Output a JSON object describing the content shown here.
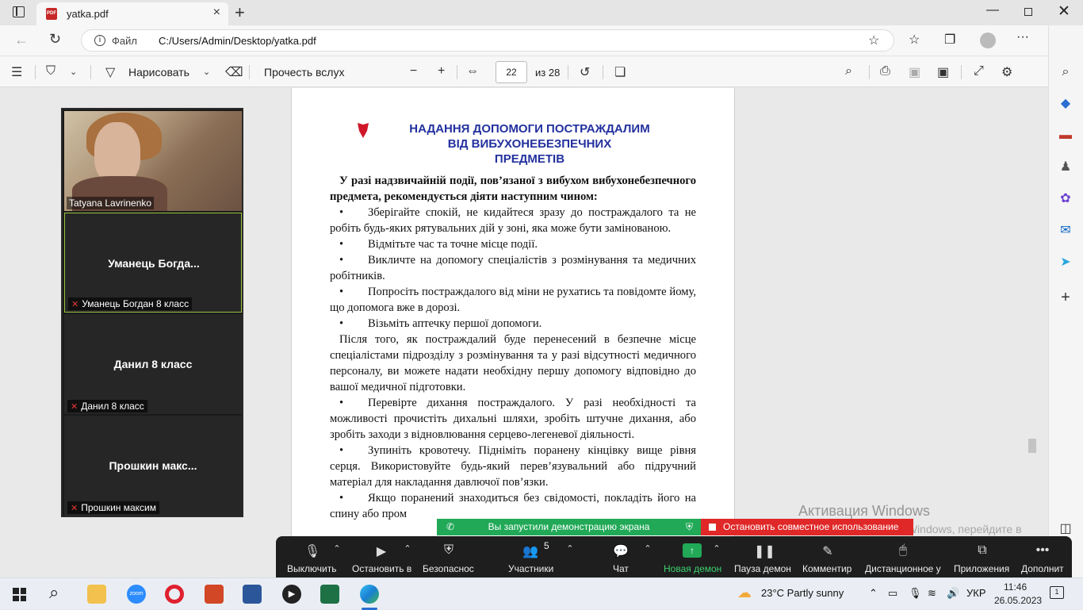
{
  "browser": {
    "tab_title": "yatka.pdf",
    "pdf_icon_label": "PDF",
    "url_prefix": "Файл",
    "url": "C:/Users/Admin/Desktop/yatka.pdf"
  },
  "pdf_toolbar": {
    "draw_label": "Нарисовать",
    "read_aloud_label": "Прочесть вслух",
    "current_page": "22",
    "page_total": "из 28"
  },
  "document": {
    "heading_line1": "НАДАННЯ ДОПОМОГИ ПОСТРАЖДАЛИМ",
    "heading_line2": "ВІД ВИБУХОНЕБЕЗПЕЧНИХ",
    "heading_line3": "ПРЕДМЕТІВ",
    "intro": "У разі надзвичайній події, пов’язаної з вибухом вибухонебезпечного предмета, рекомендується діяти наступним чином:",
    "bullets1": [
      "Зберігайте спокій, не кидайтеся зразу до постраждалого та не робіть будь-яких рятувальних дій у зоні, яка може бути замінованою.",
      "Відмітьте час та точне місце події.",
      "Викличте на допомогу спеціалістів з розмінування та медичних робітників.",
      "Попросіть постраждалого від міни не рухатись та повідомте йому, що допомога вже в дорозі.",
      "Візьміть аптечку першої допомоги."
    ],
    "para2": "Після того, як постраждалий буде перенесений в безпечне місце спеціалістами підрозділу з розмінування та у разі відсутності медичного персоналу, ви можете надати необхідну першу допомогу відповідно до вашої медичної підготовки.",
    "bullets2": [
      "Перевірте дихання постраждалого. У разі необхідності та можливості прочистіть дихальні шляхи, зробіть штучне дихання, або зробіть заходи з відновлювання серцево-легеневої діяльності.",
      "Зупиніть кровотечу. Підніміть поранену кінцівку вище рівня серця. Використовуйте будь-який перев’язувальний або підручний матеріал для накладання давлючої пов’язки.",
      "Якщо поранений знаходиться без свідомості, покладіть його на спину або пром"
    ]
  },
  "zoom": {
    "participants": [
      {
        "video_label": "Tatyana Lavrinenko"
      },
      {
        "name": "Уманець  Богда...",
        "label": "Уманець Богдан 8 класс"
      },
      {
        "name": "Данил 8 класс",
        "label": "Данил 8 класс"
      },
      {
        "name": "Прошкин  макс...",
        "label": "Прошкин максим"
      }
    ],
    "share_banner": "Вы запустили демонстрацию экрана",
    "stop_share": "Остановить совместное использование",
    "participants_count": "5",
    "toolbar": [
      "Выключить",
      "Остановить в",
      "Безопаснос",
      "Участники",
      "Чат",
      "Новая демон",
      "Пауза демон",
      "Комментир",
      "Дистанционное у",
      "Приложения",
      "Дополнит"
    ]
  },
  "watermark": {
    "title": "Активация Windows",
    "text": "Чтобы активировать Windows, перейдите в раздел \"Параметры\"."
  },
  "taskbar": {
    "weather": "23°C  Partly sunny",
    "lang": "УКР",
    "time": "11:46",
    "date": "26.05.2023",
    "notif_count": "1"
  }
}
